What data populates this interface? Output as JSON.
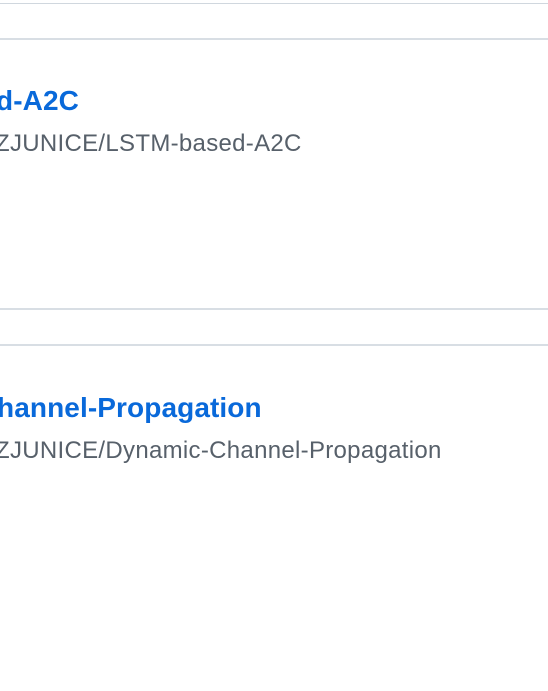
{
  "repos": [
    {
      "title": "d-A2C",
      "path": "ZJUNICE/LSTM-based-A2C"
    },
    {
      "title": "hannel-Propagation",
      "path": "ZJUNICE/Dynamic-Channel-Propagation"
    }
  ],
  "colors": {
    "link": "#0969da",
    "muted_text": "#57606a",
    "border": "#d0d7de",
    "background": "#ffffff"
  }
}
